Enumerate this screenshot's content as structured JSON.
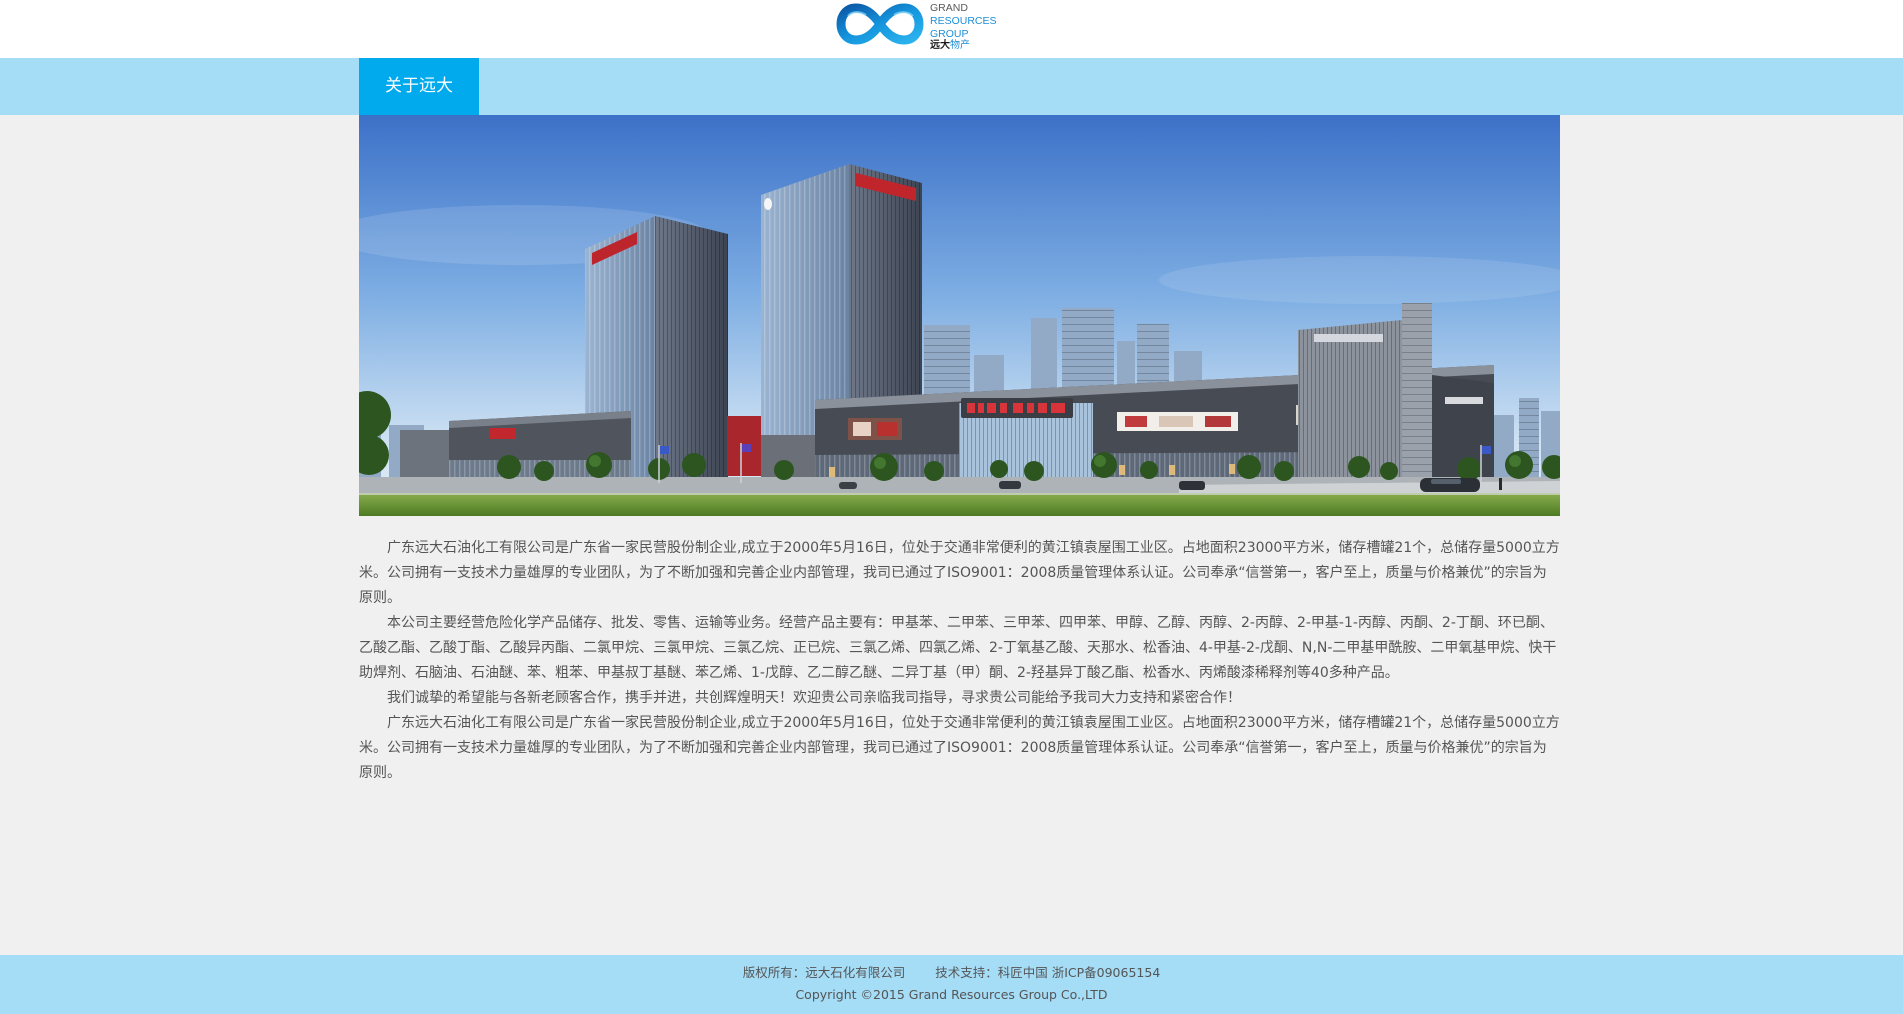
{
  "header": {
    "logo": {
      "line1": "GRAND",
      "line2": "RESOURCES",
      "line3": "GROUP",
      "cn_main": "远大",
      "cn_accent": "物产"
    }
  },
  "nav": {
    "items": [
      {
        "label": "关于远大"
      }
    ]
  },
  "main": {
    "paragraphs": [
      "广东远大石油化工有限公司是广东省一家民营股份制企业,成立于2000年5月16日，位处于交通非常便利的黄江镇袁屋围工业区。占地面积23000平方米，储存槽罐21个，总储存量5000立方米。公司拥有一支技术力量雄厚的专业团队，为了不断加强和完善企业内部管理，我司已通过了ISO9001：2008质量管理体系认证。公司奉承“信誉第一，客户至上，质量与价格兼优”的宗旨为原则。",
      "本公司主要经营危险化学产品储存、批发、零售、运输等业务。经营产品主要有：甲基苯、二甲苯、三甲苯、四甲苯、甲醇、乙醇、丙醇、2-丙醇、2-甲基-1-丙醇、丙酮、2-丁酮、环已酮、乙酸乙酯、乙酸丁酯、乙酸异丙酯、二氯甲烷、三氯甲烷、三氯乙烷、正已烷、三氯乙烯、四氯乙烯、2-丁氧基乙酸、天那水、松香油、4-甲基-2-戊酮、N,N-二甲基甲酰胺、二甲氧基甲烷、快干助焊剂、石脑油、石油醚、苯、粗苯、甲基叔丁基醚、苯乙烯、1-戊醇、乙二醇乙醚、二异丁基（甲）酮、2-羟基异丁酸乙酯、松香水、丙烯酸漆稀释剂等40多种产品。",
      "我们诚挚的希望能与各新老顾客合作，携手并进，共创辉煌明天！欢迎贵公司亲临我司指导，寻求贵公司能给予我司大力支持和紧密合作！",
      "广东远大石油化工有限公司是广东省一家民营股份制企业,成立于2000年5月16日，位处于交通非常便利的黄江镇袁屋围工业区。占地面积23000平方米，储存槽罐21个，总储存量5000立方米。公司拥有一支技术力量雄厚的专业团队，为了不断加强和完善企业内部管理，我司已通过了ISO9001：2008质量管理体系认证。公司奉承“信誉第一，客户至上，质量与价格兼优”的宗旨为原则。"
    ]
  },
  "footer": {
    "copyright_owner": "版权所有：远大石化有限公司",
    "tech_support": "技术支持：科匠中国 浙ICP备09065154",
    "copyright_line": "Copyright ©2015 Grand Resources Group Co.,LTD"
  },
  "colors": {
    "nav_bg": "#a5dcf6",
    "accent": "#00aaed",
    "page_bg": "#f0f0f0",
    "text": "#555555",
    "logo_blue": "#1c8fd8"
  }
}
